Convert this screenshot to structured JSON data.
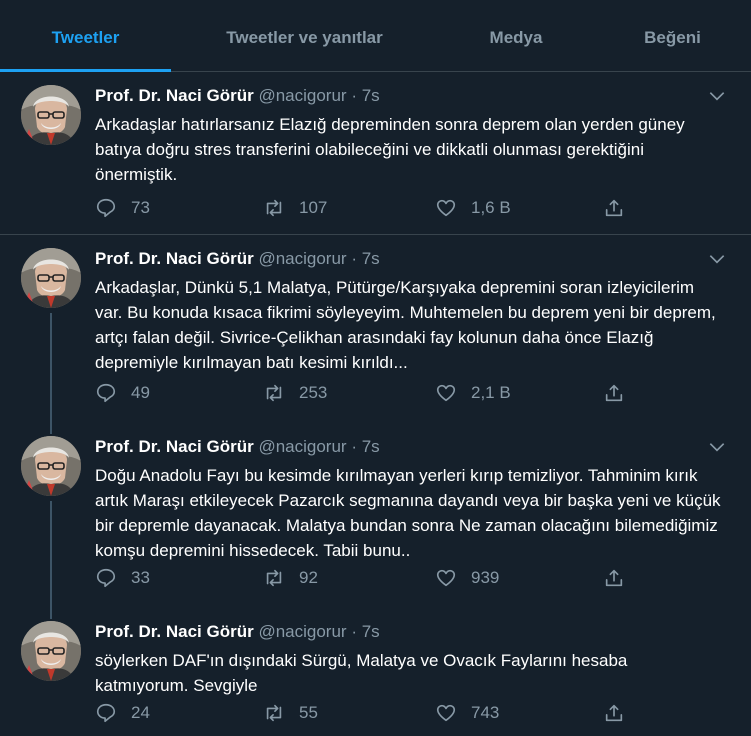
{
  "tabs": [
    "Tweetler",
    "Tweetler ve yanıtlar",
    "Medya",
    "Beğeni"
  ],
  "tweets": [
    {
      "name": "Prof. Dr. Naci Görür",
      "handle": "@nacigorur",
      "dot": "·",
      "time": "7s",
      "text": "Arkadaşlar hatırlarsanız Elazığ depreminden sonra deprem olan yerden güney batıya doğru stres transferini olabileceğini ve dikkatli olunması gerektiğini önermiştik.",
      "replies": "73",
      "retweets": "107",
      "likes": "1,6 B"
    },
    {
      "name": "Prof. Dr. Naci Görür",
      "handle": "@nacigorur",
      "dot": "·",
      "time": "7s",
      "text": "Arkadaşlar, Dünkü 5,1 Malatya, Pütürge/Karşıyaka depremini soran izleyicilerim var. Bu konuda kısaca fikrimi söyleyeyim. Muhtemelen bu deprem yeni bir deprem, artçı falan değil. Sivrice-Çelikhan arasındaki fay kolunun daha önce Elazığ depremiyle kırılmayan batı kesimi kırıldı...",
      "replies": "49",
      "retweets": "253",
      "likes": "2,1 B"
    },
    {
      "name": "Prof. Dr. Naci Görür",
      "handle": "@nacigorur",
      "dot": "·",
      "time": "7s",
      "text": "Doğu Anadolu Fayı bu kesimde kırılmayan yerleri kırıp temizliyor. Tahminim kırık artık Maraşı etkileyecek Pazarcık segmanına dayandı veya bir başka yeni ve küçük bir depremle dayanacak. Malatya bundan sonra Ne zaman olacağını bilemediğimiz komşu depremini hissedecek. Tabii bunu..",
      "replies": "33",
      "retweets": "92",
      "likes": "939"
    },
    {
      "name": "Prof. Dr. Naci Görür",
      "handle": "@nacigorur",
      "dot": "·",
      "time": "7s",
      "text": "söylerken DAF'ın dışındaki Sürgü, Malatya ve Ovacık Faylarını hesaba katmıyorum. Sevgiyle",
      "replies": "24",
      "retweets": "55",
      "likes": "743"
    }
  ],
  "icons": {
    "reply": "reply-icon",
    "retweet": "retweet-icon",
    "like": "heart-icon",
    "share": "share-icon",
    "caret": "chevron-down-icon"
  },
  "colors": {
    "background": "#15202b",
    "accent": "#1da1f2",
    "muted": "#8899a6",
    "border": "#38444d"
  }
}
